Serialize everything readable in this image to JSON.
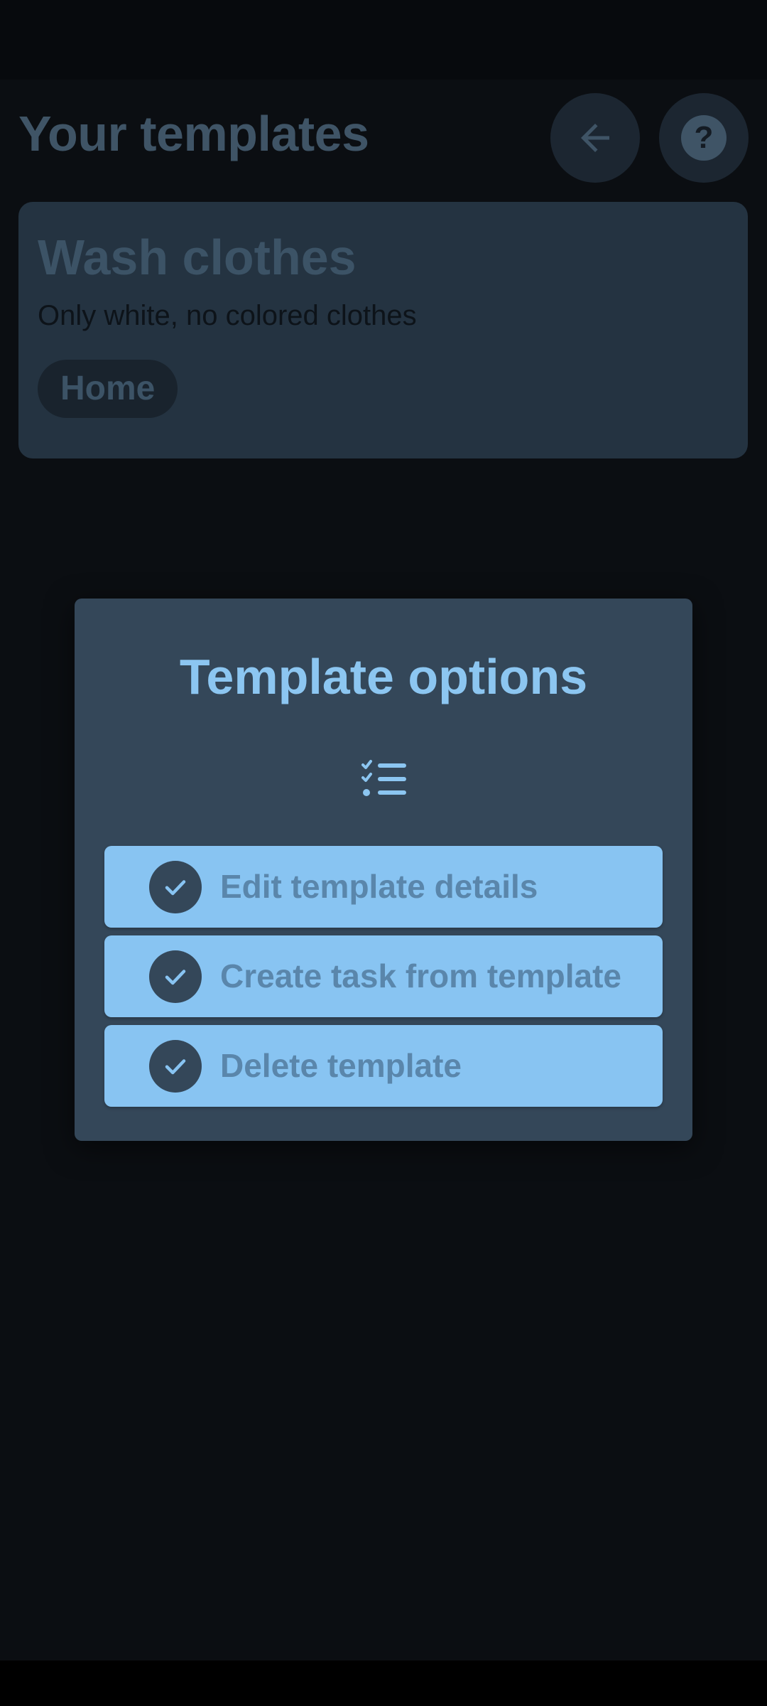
{
  "header": {
    "title": "Your templates",
    "back_icon": "arrow-left-icon",
    "help_icon": "help-icon",
    "help_glyph": "?"
  },
  "template_card": {
    "title": "Wash clothes",
    "description": "Only white, no colored clothes",
    "tag": "Home"
  },
  "dialog": {
    "title": "Template options",
    "header_icon": "checklist-icon",
    "options": [
      {
        "label": "Edit template details",
        "icon": "check-circle-icon"
      },
      {
        "label": "Create task from template",
        "icon": "check-circle-icon"
      },
      {
        "label": "Delete template",
        "icon": "check-circle-icon"
      }
    ]
  },
  "colors": {
    "background": "#0b0e12",
    "dialog": "#344759",
    "accent": "#88c4f2",
    "option_text": "#5a86ab"
  }
}
